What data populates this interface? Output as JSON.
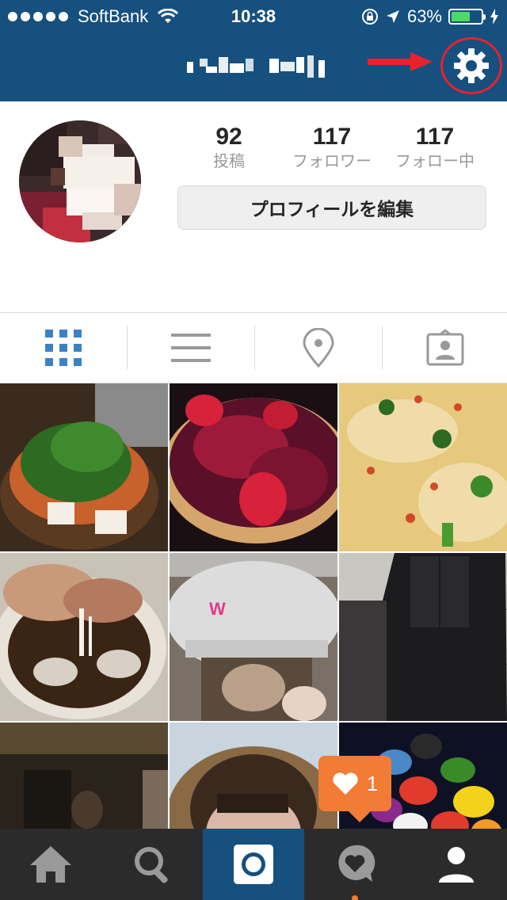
{
  "status_bar": {
    "carrier": "SoftBank",
    "time": "10:38",
    "battery_percent": "63%",
    "battery_level": 0.63,
    "icons": [
      "signal-dots-icon",
      "wifi-icon",
      "rotation-lock-icon",
      "location-arrow-icon",
      "battery-icon",
      "charging-bolt-icon"
    ]
  },
  "header": {
    "username_pixelated": true,
    "settings_icon": "gear-icon",
    "highlight_color": "#e8222c"
  },
  "profile": {
    "stats": [
      {
        "value": "92",
        "label": "投稿"
      },
      {
        "value": "117",
        "label": "フォロワー"
      },
      {
        "value": "117",
        "label": "フォロー中"
      }
    ],
    "edit_profile_label": "プロフィールを編集"
  },
  "view_tabs": [
    {
      "name": "grid-view",
      "icon": "grid-icon",
      "active": true
    },
    {
      "name": "list-view",
      "icon": "list-icon",
      "active": false
    },
    {
      "name": "photo-map",
      "icon": "location-pin-icon",
      "active": false
    },
    {
      "name": "tagged-photos",
      "icon": "person-tag-icon",
      "active": false
    }
  ],
  "photos": [
    {
      "subject": "hot pot with greens and tofu",
      "colors": [
        "#3b2a1e",
        "#2d6b22",
        "#c8612c"
      ]
    },
    {
      "subject": "berry tart with strawberries",
      "colors": [
        "#5a1028",
        "#9e1a3a",
        "#d8213a"
      ]
    },
    {
      "subject": "pizza with salmon roe",
      "colors": [
        "#e6c97d",
        "#f0dca8",
        "#d2492a"
      ]
    },
    {
      "subject": "ramen with clams",
      "colors": [
        "#3a2414",
        "#c89a7a",
        "#e8e2d8"
      ]
    },
    {
      "subject": "person wearing hat",
      "colors": [
        "#d8d8d8",
        "#e03c82",
        "#5a4a3c"
      ]
    },
    {
      "subject": "shoes on pavement",
      "colors": [
        "#c9c7c2",
        "#1c1c1f",
        "#8a8782"
      ]
    },
    {
      "subject": "dim room",
      "colors": [
        "#2a231c",
        "#5a4a34",
        "#1a1612"
      ]
    },
    {
      "subject": "person with fur hood",
      "colors": [
        "#c8d4de",
        "#8a6a44",
        "#d9b8a8"
      ]
    },
    {
      "subject": "jelly beans",
      "colors": [
        "#0e1124",
        "#e23a2c",
        "#f2d21a"
      ]
    }
  ],
  "activity_badge": {
    "count": "1",
    "icon": "heart-icon",
    "color": "#f27b35"
  },
  "bottom_tabs": [
    {
      "name": "home",
      "icon": "home-icon",
      "active": false
    },
    {
      "name": "search",
      "icon": "search-icon",
      "active": false
    },
    {
      "name": "camera",
      "icon": "camera-icon",
      "active": false
    },
    {
      "name": "activity",
      "icon": "heart-bubble-icon",
      "active": false
    },
    {
      "name": "profile",
      "icon": "profile-icon",
      "active": true
    }
  ],
  "colors": {
    "nav_blue": "#16507f",
    "tab_bar": "#2b2b2b",
    "grid_active": "#3b82c4"
  }
}
